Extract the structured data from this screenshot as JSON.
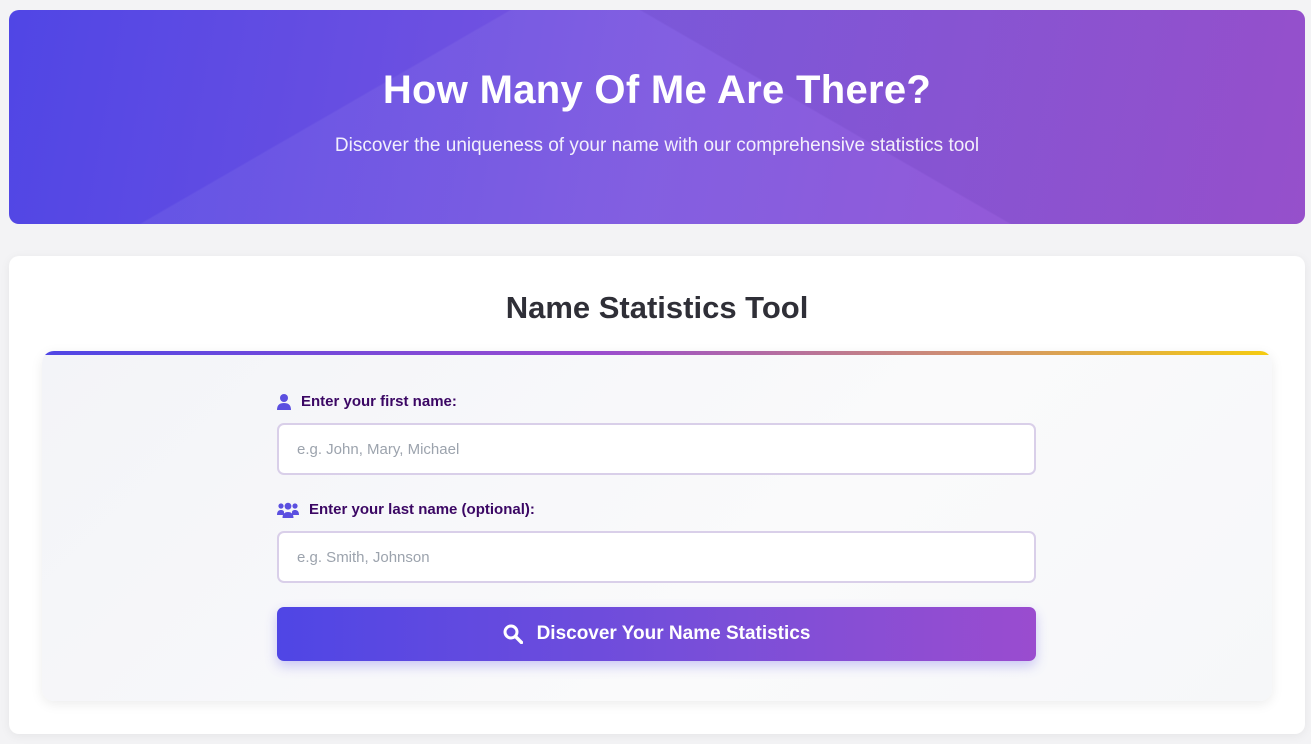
{
  "hero": {
    "title": "How Many Of Me Are There?",
    "subtitle": "Discover the uniqueness of your name with our comprehensive statistics tool"
  },
  "tool": {
    "heading": "Name Statistics Tool",
    "first_name": {
      "label": "Enter your first name:",
      "icon": "user-icon",
      "placeholder": "e.g. John, Mary, Michael",
      "value": ""
    },
    "last_name": {
      "label": "Enter your last name (optional):",
      "icon": "users-icon",
      "placeholder": "e.g. Smith, Johnson",
      "value": ""
    },
    "submit": {
      "label": "Discover Your Name Statistics",
      "icon": "search-icon"
    }
  },
  "colors": {
    "accent_start": "#4f46e5",
    "accent_end": "#9a4ccf",
    "label_color": "#3b0764",
    "gold_accent": "#f5cc10"
  }
}
